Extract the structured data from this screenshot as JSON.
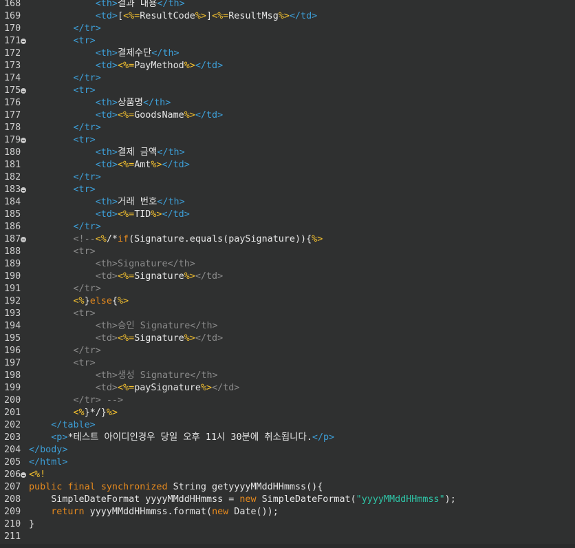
{
  "colors": {
    "background": "#2f3030",
    "line_number": "#d0d0d0",
    "tag": "#3d9fd8",
    "jsp_delimiter": "#f6c22f",
    "keyword": "#e68a1e",
    "string": "#2ec4a6",
    "comment": "#8a8a8a",
    "text": "#e6e6e6"
  },
  "lines": [
    {
      "num": "168",
      "fold": false,
      "tokens": [
        [
          "            ",
          "t-plain"
        ],
        [
          "<th>",
          "t-tag"
        ],
        [
          "결과 내용",
          "t-text"
        ],
        [
          "</th>",
          "t-tag"
        ]
      ]
    },
    {
      "num": "169",
      "fold": false,
      "tokens": [
        [
          "            ",
          "t-plain"
        ],
        [
          "<td>",
          "t-tag"
        ],
        [
          "[",
          "t-text"
        ],
        [
          "<%=",
          "t-jsp"
        ],
        [
          "ResultCode",
          "t-expr"
        ],
        [
          "%>",
          "t-jsp"
        ],
        [
          "]",
          "t-text"
        ],
        [
          "<%=",
          "t-jsp"
        ],
        [
          "ResultMsg",
          "t-expr"
        ],
        [
          "%>",
          "t-jsp"
        ],
        [
          "</td>",
          "t-tag"
        ]
      ]
    },
    {
      "num": "170",
      "fold": false,
      "tokens": [
        [
          "        ",
          "t-plain"
        ],
        [
          "</tr>",
          "t-tag"
        ]
      ]
    },
    {
      "num": "171",
      "fold": true,
      "tokens": [
        [
          "        ",
          "t-plain"
        ],
        [
          "<tr>",
          "t-tag"
        ]
      ]
    },
    {
      "num": "172",
      "fold": false,
      "tokens": [
        [
          "            ",
          "t-plain"
        ],
        [
          "<th>",
          "t-tag"
        ],
        [
          "결제수단",
          "t-text"
        ],
        [
          "</th>",
          "t-tag"
        ]
      ]
    },
    {
      "num": "173",
      "fold": false,
      "tokens": [
        [
          "            ",
          "t-plain"
        ],
        [
          "<td>",
          "t-tag"
        ],
        [
          "<%=",
          "t-jsp"
        ],
        [
          "PayMethod",
          "t-expr"
        ],
        [
          "%>",
          "t-jsp"
        ],
        [
          "</td>",
          "t-tag"
        ]
      ]
    },
    {
      "num": "174",
      "fold": false,
      "tokens": [
        [
          "        ",
          "t-plain"
        ],
        [
          "</tr>",
          "t-tag"
        ]
      ]
    },
    {
      "num": "175",
      "fold": true,
      "tokens": [
        [
          "        ",
          "t-plain"
        ],
        [
          "<tr>",
          "t-tag"
        ]
      ]
    },
    {
      "num": "176",
      "fold": false,
      "tokens": [
        [
          "            ",
          "t-plain"
        ],
        [
          "<th>",
          "t-tag"
        ],
        [
          "상품명",
          "t-text"
        ],
        [
          "</th>",
          "t-tag"
        ]
      ]
    },
    {
      "num": "177",
      "fold": false,
      "tokens": [
        [
          "            ",
          "t-plain"
        ],
        [
          "<td>",
          "t-tag"
        ],
        [
          "<%=",
          "t-jsp"
        ],
        [
          "GoodsName",
          "t-expr"
        ],
        [
          "%>",
          "t-jsp"
        ],
        [
          "</td>",
          "t-tag"
        ]
      ]
    },
    {
      "num": "178",
      "fold": false,
      "tokens": [
        [
          "        ",
          "t-plain"
        ],
        [
          "</tr>",
          "t-tag"
        ]
      ]
    },
    {
      "num": "179",
      "fold": true,
      "tokens": [
        [
          "        ",
          "t-plain"
        ],
        [
          "<tr>",
          "t-tag"
        ]
      ]
    },
    {
      "num": "180",
      "fold": false,
      "tokens": [
        [
          "            ",
          "t-plain"
        ],
        [
          "<th>",
          "t-tag"
        ],
        [
          "결제 금액",
          "t-text"
        ],
        [
          "</th>",
          "t-tag"
        ]
      ]
    },
    {
      "num": "181",
      "fold": false,
      "tokens": [
        [
          "            ",
          "t-plain"
        ],
        [
          "<td>",
          "t-tag"
        ],
        [
          "<%=",
          "t-jsp"
        ],
        [
          "Amt",
          "t-expr"
        ],
        [
          "%>",
          "t-jsp"
        ],
        [
          "</td>",
          "t-tag"
        ]
      ]
    },
    {
      "num": "182",
      "fold": false,
      "tokens": [
        [
          "        ",
          "t-plain"
        ],
        [
          "</tr>",
          "t-tag"
        ]
      ]
    },
    {
      "num": "183",
      "fold": true,
      "tokens": [
        [
          "        ",
          "t-plain"
        ],
        [
          "<tr>",
          "t-tag"
        ]
      ]
    },
    {
      "num": "184",
      "fold": false,
      "tokens": [
        [
          "            ",
          "t-plain"
        ],
        [
          "<th>",
          "t-tag"
        ],
        [
          "거래 번호",
          "t-text"
        ],
        [
          "</th>",
          "t-tag"
        ]
      ]
    },
    {
      "num": "185",
      "fold": false,
      "tokens": [
        [
          "            ",
          "t-plain"
        ],
        [
          "<td>",
          "t-tag"
        ],
        [
          "<%=",
          "t-jsp"
        ],
        [
          "TID",
          "t-expr"
        ],
        [
          "%>",
          "t-jsp"
        ],
        [
          "</td>",
          "t-tag"
        ]
      ]
    },
    {
      "num": "186",
      "fold": false,
      "tokens": [
        [
          "        ",
          "t-plain"
        ],
        [
          "</tr>",
          "t-tag"
        ]
      ]
    },
    {
      "num": "187",
      "fold": true,
      "tokens": [
        [
          "        ",
          "t-plain"
        ],
        [
          "<!--",
          "t-cm"
        ],
        [
          "<%",
          "t-jsp"
        ],
        [
          "/*",
          "t-plain"
        ],
        [
          "if",
          "t-kw"
        ],
        [
          "(Signature.equals(paySignature)){",
          "t-plain"
        ],
        [
          "%>",
          "t-jsp"
        ]
      ]
    },
    {
      "num": "188",
      "fold": false,
      "tokens": [
        [
          "        ",
          "t-plain"
        ],
        [
          "<tr>",
          "t-cm"
        ]
      ]
    },
    {
      "num": "189",
      "fold": false,
      "tokens": [
        [
          "            ",
          "t-plain"
        ],
        [
          "<th>Signature</th>",
          "t-cm"
        ]
      ]
    },
    {
      "num": "190",
      "fold": false,
      "tokens": [
        [
          "            ",
          "t-plain"
        ],
        [
          "<td>",
          "t-cm"
        ],
        [
          "<%=",
          "t-jsp"
        ],
        [
          "Signature",
          "t-expr"
        ],
        [
          "%>",
          "t-jsp"
        ],
        [
          "</td>",
          "t-cm"
        ]
      ]
    },
    {
      "num": "191",
      "fold": false,
      "tokens": [
        [
          "        ",
          "t-plain"
        ],
        [
          "</tr>",
          "t-cm"
        ]
      ]
    },
    {
      "num": "192",
      "fold": false,
      "tokens": [
        [
          "        ",
          "t-plain"
        ],
        [
          "<%",
          "t-jsp"
        ],
        [
          "}",
          "t-plain"
        ],
        [
          "else",
          "t-kw"
        ],
        [
          "{",
          "t-plain"
        ],
        [
          "%>",
          "t-jsp"
        ]
      ]
    },
    {
      "num": "193",
      "fold": false,
      "tokens": [
        [
          "        ",
          "t-plain"
        ],
        [
          "<tr>",
          "t-cm"
        ]
      ]
    },
    {
      "num": "194",
      "fold": false,
      "tokens": [
        [
          "            ",
          "t-plain"
        ],
        [
          "<th>승인 Signature</th>",
          "t-cm"
        ]
      ]
    },
    {
      "num": "195",
      "fold": false,
      "tokens": [
        [
          "            ",
          "t-plain"
        ],
        [
          "<td>",
          "t-cm"
        ],
        [
          "<%=",
          "t-jsp"
        ],
        [
          "Signature",
          "t-expr"
        ],
        [
          "%>",
          "t-jsp"
        ],
        [
          "</td>",
          "t-cm"
        ]
      ]
    },
    {
      "num": "196",
      "fold": false,
      "tokens": [
        [
          "        ",
          "t-plain"
        ],
        [
          "</tr>",
          "t-cm"
        ]
      ]
    },
    {
      "num": "197",
      "fold": false,
      "tokens": [
        [
          "        ",
          "t-plain"
        ],
        [
          "<tr>",
          "t-cm"
        ]
      ]
    },
    {
      "num": "198",
      "fold": false,
      "tokens": [
        [
          "            ",
          "t-plain"
        ],
        [
          "<th>생성 Signature</th>",
          "t-cm"
        ]
      ]
    },
    {
      "num": "199",
      "fold": false,
      "tokens": [
        [
          "            ",
          "t-plain"
        ],
        [
          "<td>",
          "t-cm"
        ],
        [
          "<%=",
          "t-jsp"
        ],
        [
          "paySignature",
          "t-expr"
        ],
        [
          "%>",
          "t-jsp"
        ],
        [
          "</td>",
          "t-cm"
        ]
      ]
    },
    {
      "num": "200",
      "fold": false,
      "tokens": [
        [
          "        ",
          "t-plain"
        ],
        [
          "</tr> -->",
          "t-cm"
        ]
      ]
    },
    {
      "num": "201",
      "fold": false,
      "tokens": [
        [
          "        ",
          "t-plain"
        ],
        [
          "<%",
          "t-jsp"
        ],
        [
          "}*/}",
          "t-plain"
        ],
        [
          "%>",
          "t-jsp"
        ]
      ]
    },
    {
      "num": "202",
      "fold": false,
      "tokens": [
        [
          "    ",
          "t-plain"
        ],
        [
          "</table>",
          "t-tag"
        ]
      ]
    },
    {
      "num": "203",
      "fold": false,
      "tokens": [
        [
          "    ",
          "t-plain"
        ],
        [
          "<p>",
          "t-tag"
        ],
        [
          "*테스트 아이디인경우 당일 오후 11시 30분에 취소됩니다.",
          "t-text"
        ],
        [
          "</p>",
          "t-tag"
        ]
      ]
    },
    {
      "num": "204",
      "fold": false,
      "tokens": [
        [
          "</body>",
          "t-tag"
        ]
      ]
    },
    {
      "num": "205",
      "fold": false,
      "tokens": [
        [
          "</html>",
          "t-tag"
        ]
      ]
    },
    {
      "num": "206",
      "fold": true,
      "tokens": [
        [
          "<%!",
          "t-jsp"
        ]
      ]
    },
    {
      "num": "207",
      "fold": false,
      "tokens": [
        [
          "public",
          "t-kw"
        ],
        [
          " ",
          "t-plain"
        ],
        [
          "final",
          "t-kw"
        ],
        [
          " ",
          "t-plain"
        ],
        [
          "synchronized",
          "t-kw"
        ],
        [
          " String getyyyyMMddHHmmss(){",
          "t-plain"
        ]
      ]
    },
    {
      "num": "208",
      "fold": false,
      "tokens": [
        [
          "    SimpleDateFormat yyyyMMddHHmmss = ",
          "t-plain"
        ],
        [
          "new",
          "t-kw"
        ],
        [
          " SimpleDateFormat(",
          "t-plain"
        ],
        [
          "\"yyyyMMddHHmmss\"",
          "t-str"
        ],
        [
          ");",
          "t-plain"
        ]
      ]
    },
    {
      "num": "209",
      "fold": false,
      "tokens": [
        [
          "    ",
          "t-plain"
        ],
        [
          "return",
          "t-kw"
        ],
        [
          " yyyyMMddHHmmss.format(",
          "t-plain"
        ],
        [
          "new",
          "t-kw"
        ],
        [
          " Date());",
          "t-plain"
        ]
      ]
    },
    {
      "num": "210",
      "fold": false,
      "tokens": [
        [
          "}",
          "t-plain"
        ]
      ]
    },
    {
      "num": "211",
      "fold": false,
      "tokens": []
    }
  ]
}
